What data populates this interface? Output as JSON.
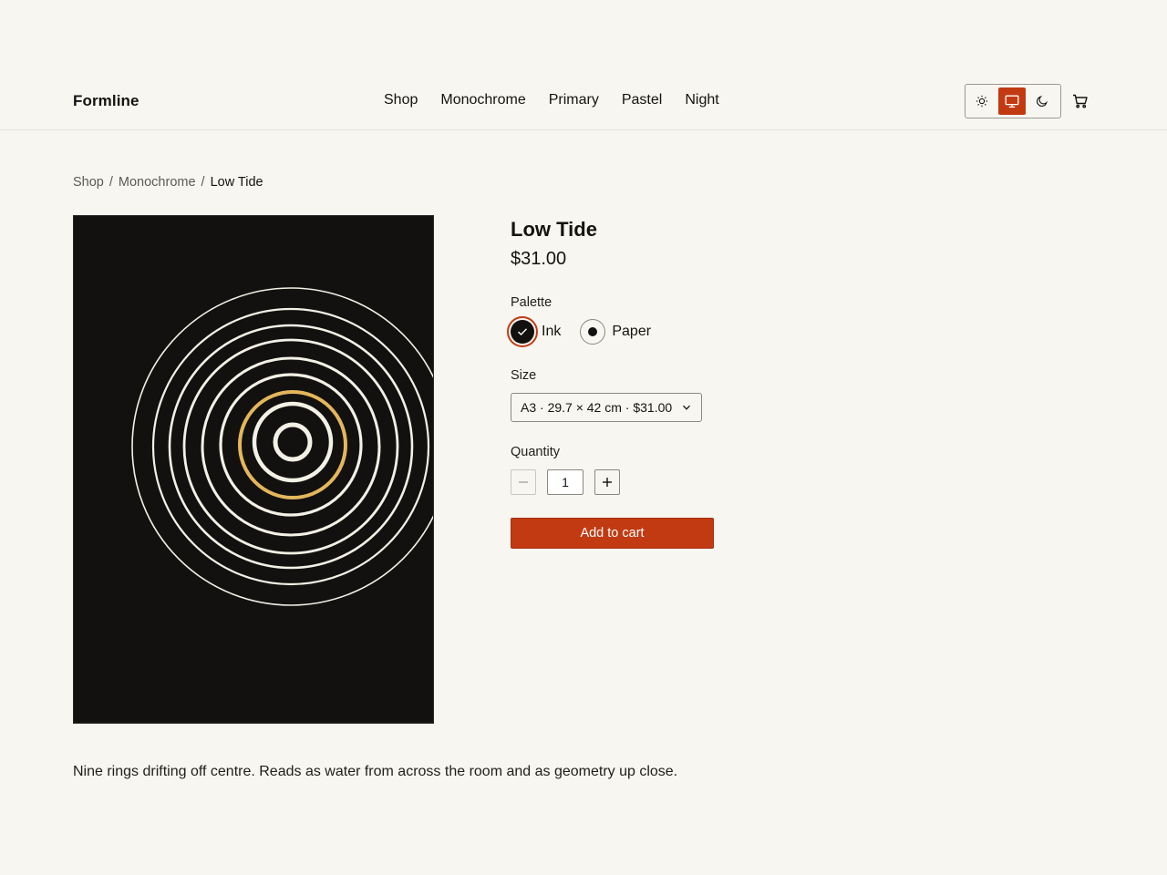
{
  "header": {
    "brand": "Formline",
    "nav": [
      "Shop",
      "Monochrome",
      "Primary",
      "Pastel",
      "Night"
    ],
    "theme": {
      "options": [
        "light",
        "system",
        "dark"
      ],
      "active": "system"
    }
  },
  "breadcrumb": {
    "items": [
      "Shop",
      "Monochrome"
    ],
    "current": "Low Tide",
    "separator": "/"
  },
  "product": {
    "title": "Low Tide",
    "price": "$31.00",
    "palette_label": "Palette",
    "palette_options": [
      {
        "name": "Ink",
        "color": "#12110f",
        "selected": true
      },
      {
        "name": "Paper",
        "color": "#f7f6f1",
        "selected": false
      }
    ],
    "size_label": "Size",
    "size_value": "A3 · 29.7 × 42 cm · $31.00",
    "quantity_label": "Quantity",
    "quantity_value": "1",
    "add_to_cart": "Add to cart",
    "description": "Nine rings drifting off centre. Reads as water from across the room and as geometry up close."
  },
  "colors": {
    "accent": "#c23a12",
    "background": "#f7f6f1",
    "text": "#141310",
    "ring_white": "#f3f0e6",
    "ring_gold": "#e4b65c"
  },
  "icons": {
    "light": "sun-icon",
    "system": "monitor-icon",
    "dark": "moon-icon",
    "cart": "cart-icon",
    "check": "check-icon",
    "minus": "minus-icon",
    "plus": "plus-icon",
    "chevron": "chevron-down-icon"
  }
}
